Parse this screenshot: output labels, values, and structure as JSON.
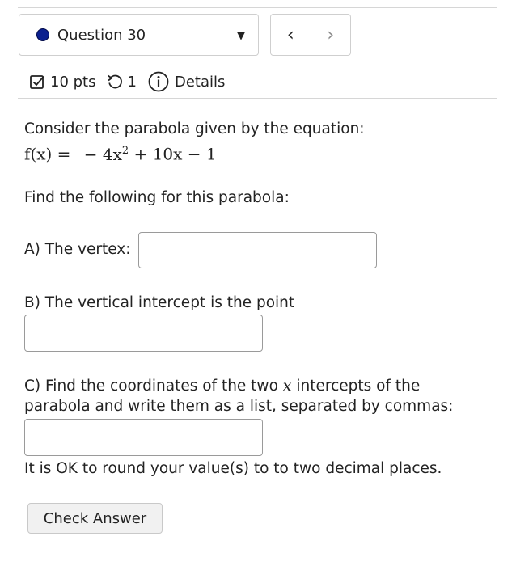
{
  "question_nav": {
    "question_label": "Question 30",
    "prev_label": "‹",
    "next_label": "›",
    "caret": "▼"
  },
  "meta": {
    "points": "10 pts",
    "attempts": "1",
    "details_label": "Details"
  },
  "problem": {
    "intro": "Consider the parabola given by the equation:",
    "equation": {
      "lhs": "f(x) =",
      "rhs_prefix": "− 4x",
      "exponent": "2",
      "rhs_suffix": " + 10x − 1"
    },
    "prompt": "Find the following for this parabola:",
    "part_a_label": "A) The vertex:",
    "part_b_label": "B) The vertical intercept is the point",
    "part_c_line1_pre": "C) Find the coordinates of the two ",
    "part_c_var": "x",
    "part_c_line1_post": " intercepts of the",
    "part_c_line2": "parabola and write them as a list, separated by commas:",
    "rounding_note": "It is OK to round your value(s) to to two decimal places."
  },
  "inputs": {
    "vertex_value": "",
    "vertical_intercept_value": "",
    "x_intercepts_value": ""
  },
  "actions": {
    "check_answer_label": "Check Answer"
  }
}
